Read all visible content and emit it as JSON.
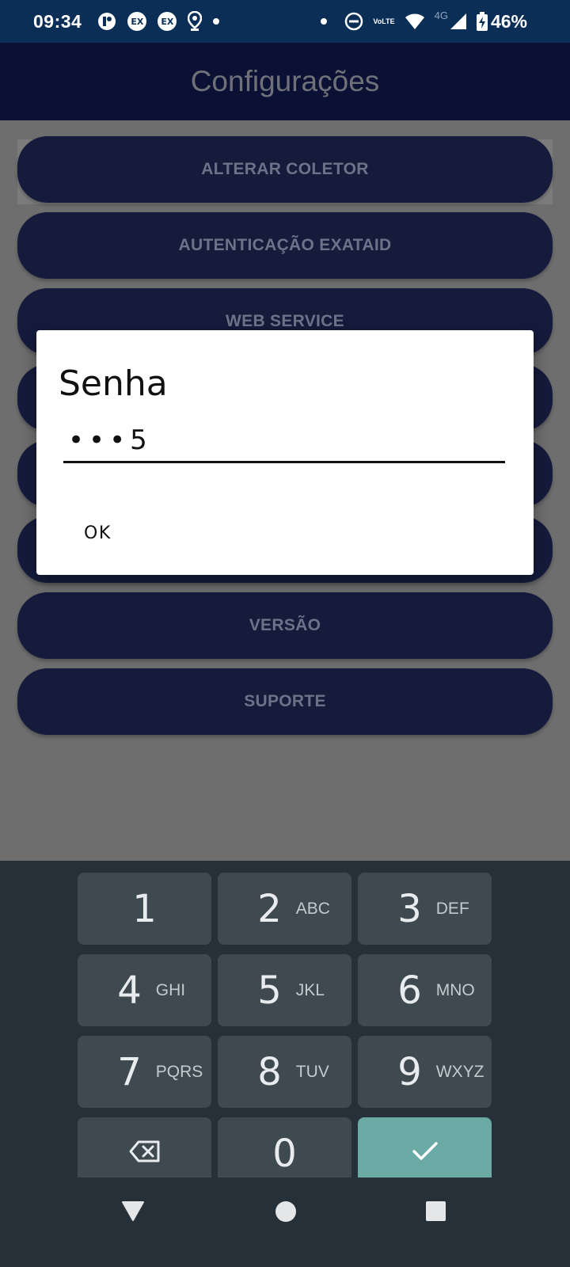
{
  "status_bar": {
    "time": "09:34",
    "left_icons": [
      "app-circle-icon",
      "ex-badge-icon",
      "ex-badge-icon",
      "location-icon",
      "dot-icon"
    ],
    "ex_badge_text": "EX",
    "network": "4G",
    "volte_top": "Vo",
    "volte_bottom": "LTE",
    "battery_percent": "46%"
  },
  "app_bar": {
    "title": "Configurações"
  },
  "menu": {
    "items": [
      {
        "label": "ALTERAR COLETOR"
      },
      {
        "label": "AUTENTICAÇÃO EXATAID"
      },
      {
        "label": "WEB SERVICE"
      },
      {
        "label": ""
      },
      {
        "label": ""
      },
      {
        "label": ""
      },
      {
        "label": "VERSÃO"
      },
      {
        "label": "SUPORTE"
      }
    ]
  },
  "dialog": {
    "title": "Senha",
    "password_display": "•••5",
    "ok_label": "OK"
  },
  "keyboard": {
    "keys": [
      {
        "num": "1",
        "letters": ""
      },
      {
        "num": "2",
        "letters": "ABC"
      },
      {
        "num": "3",
        "letters": "DEF"
      },
      {
        "num": "4",
        "letters": "GHI"
      },
      {
        "num": "5",
        "letters": "JKL"
      },
      {
        "num": "6",
        "letters": "MNO"
      },
      {
        "num": "7",
        "letters": "PQRS"
      },
      {
        "num": "8",
        "letters": "TUV"
      },
      {
        "num": "9",
        "letters": "WXYZ"
      },
      {
        "num": "0",
        "letters": ""
      }
    ]
  },
  "colors": {
    "status_bar": "#0a2e55",
    "app_bar": "#0b1035",
    "menu_button": "#141b3b",
    "overlay": "#6e6e6e",
    "keyboard_bg": "#263038",
    "key_bg": "#3f4950",
    "check_key": "#6aa9a4"
  }
}
